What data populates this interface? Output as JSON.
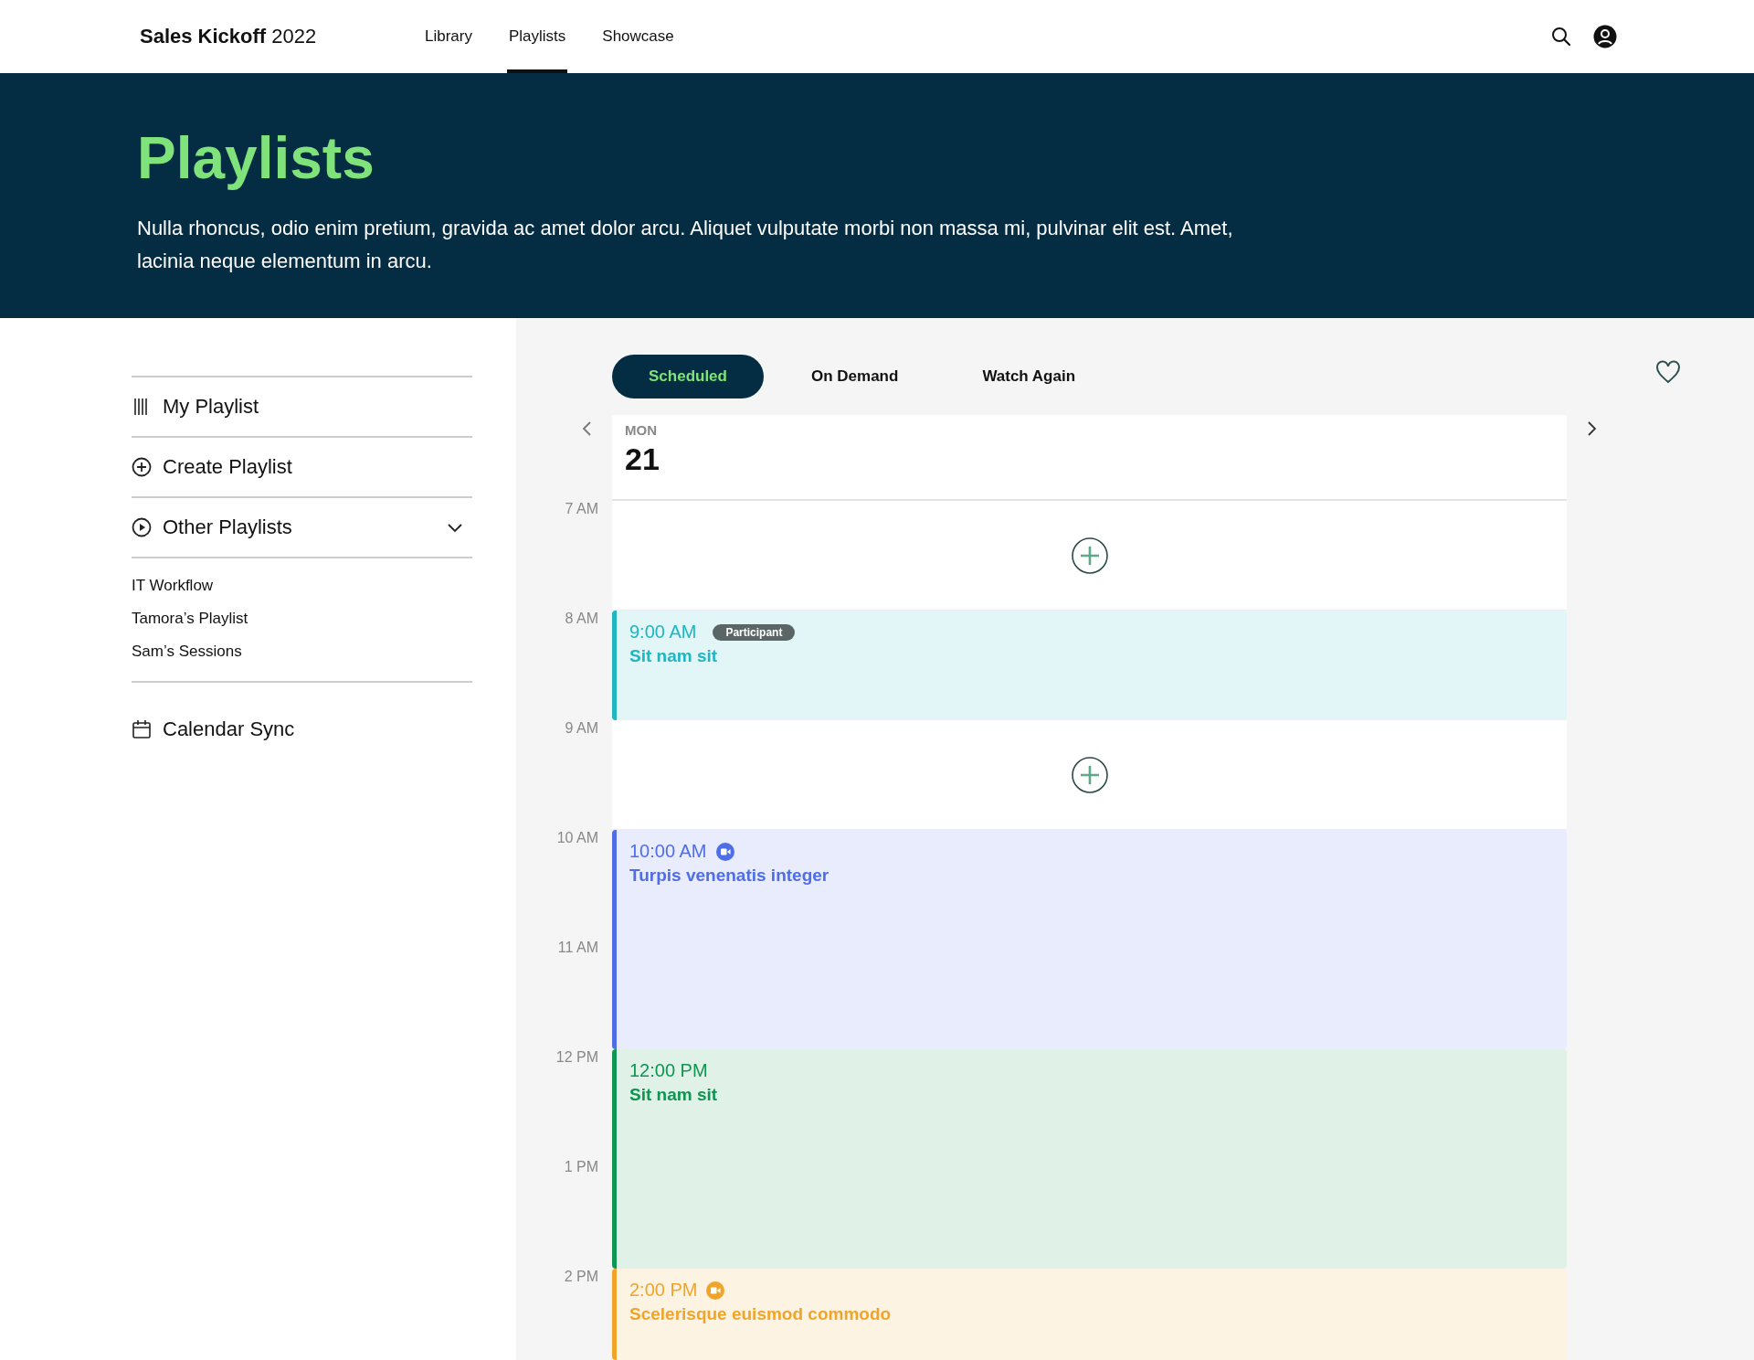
{
  "header": {
    "brand_bold": "Sales Kickoff",
    "brand_light": "2022",
    "nav": [
      {
        "label": "Library",
        "selected": false
      },
      {
        "label": "Playlists",
        "selected": true
      },
      {
        "label": "Showcase",
        "selected": false
      }
    ]
  },
  "hero": {
    "title": "Playlists",
    "text": "Nulla rhoncus, odio enim pretium, gravida ac amet dolor arcu. Aliquet vulputate morbi non massa mi, pulvinar elit est. Amet, lacinia neque elementum in arcu."
  },
  "sidebar": {
    "items": [
      {
        "kind": "bars",
        "label": "My Playlist"
      },
      {
        "kind": "plus",
        "label": "Create Playlist"
      },
      {
        "kind": "play",
        "label": "Other Playlists",
        "expanded": true,
        "children": [
          {
            "label": "IT Workflow"
          },
          {
            "label": "Tamora’s Playlist"
          },
          {
            "label": "Sam’s Sessions"
          }
        ]
      }
    ],
    "calendar_sync": "Calendar Sync"
  },
  "tabs": [
    {
      "label": "Scheduled",
      "selected": true
    },
    {
      "label": "On Demand",
      "selected": false
    },
    {
      "label": "Watch Again",
      "selected": false
    }
  ],
  "favorite": false,
  "day": {
    "weekday": "MON",
    "date": "21"
  },
  "hours": [
    "7 AM",
    "8 AM",
    "9 AM",
    "10 AM",
    "11 AM",
    "12 PM",
    "1 PM",
    "2 PM"
  ],
  "slots": [
    {
      "kind": "open"
    },
    {
      "kind": "short",
      "time": "9:00 AM",
      "title": "Sit nam sit",
      "color": "#1fb5c1",
      "badge": "Participant",
      "video": false
    },
    {
      "kind": "open"
    },
    {
      "kind": "long",
      "time": "10:00 AM",
      "title": "Turpis venenatis integer",
      "color": "#4f6ee6",
      "video": true
    },
    {
      "kind": "long",
      "time": "12:00 PM",
      "title": "Sit nam sit",
      "color": "#0e9550",
      "video": false
    },
    {
      "kind": "tail",
      "time": "2:00 PM",
      "title": "Scelerisque euismod commodo",
      "color": "#f0a52a",
      "video": true
    }
  ]
}
